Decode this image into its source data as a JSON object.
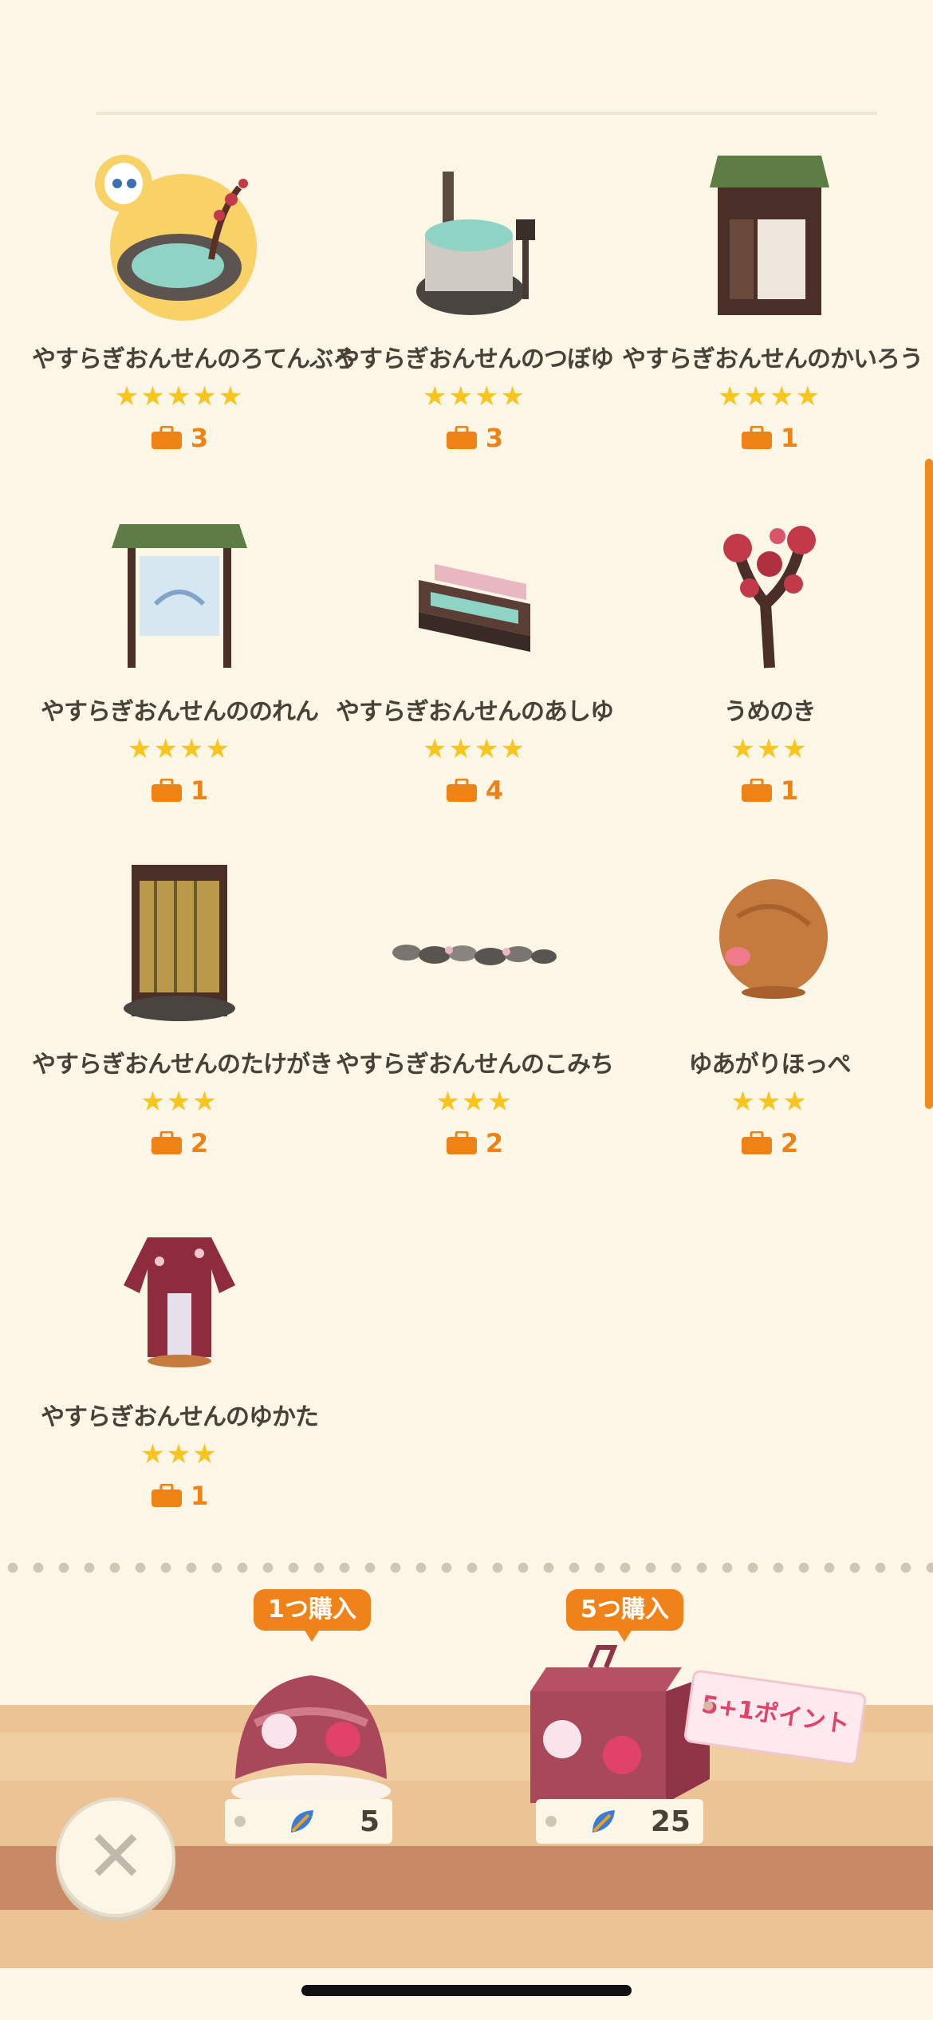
{
  "items": [
    {
      "name": "やすらぎおんせんのろてんぶろ",
      "stars": "★★★★★",
      "count": "3",
      "icon": "open-air-bath-icon"
    },
    {
      "name": "やすらぎおんせんのつぼゆ",
      "stars": "★★★★",
      "count": "3",
      "icon": "pot-bath-icon"
    },
    {
      "name": "やすらぎおんせんのかいろう",
      "stars": "★★★★",
      "count": "1",
      "icon": "corridor-icon"
    },
    {
      "name": "やすらぎおんせんののれん",
      "stars": "★★★★",
      "count": "1",
      "icon": "noren-curtain-icon"
    },
    {
      "name": "やすらぎおんせんのあしゆ",
      "stars": "★★★★",
      "count": "4",
      "icon": "foot-bath-icon"
    },
    {
      "name": "うめのき",
      "stars": "★★★",
      "count": "1",
      "icon": "plum-tree-icon"
    },
    {
      "name": "やすらぎおんせんのたけがき",
      "stars": "★★★",
      "count": "2",
      "icon": "bamboo-fence-icon"
    },
    {
      "name": "やすらぎおんせんのこみち",
      "stars": "★★★",
      "count": "2",
      "icon": "stone-path-icon"
    },
    {
      "name": "ゆあがりほっぺ",
      "stars": "★★★",
      "count": "2",
      "icon": "flushed-cheeks-icon"
    },
    {
      "name": "やすらぎおんせんのゆかた",
      "stars": "★★★",
      "count": "1",
      "icon": "yukata-icon"
    }
  ],
  "purchase": {
    "single": {
      "label": "1つ購入",
      "price": "5"
    },
    "bundle": {
      "label": "5つ購入",
      "price": "25",
      "bonus": "5+1ポイント"
    }
  },
  "colors": {
    "accent": "#f0821a",
    "star": "#f8c51f",
    "bonus": "#e0426a"
  }
}
